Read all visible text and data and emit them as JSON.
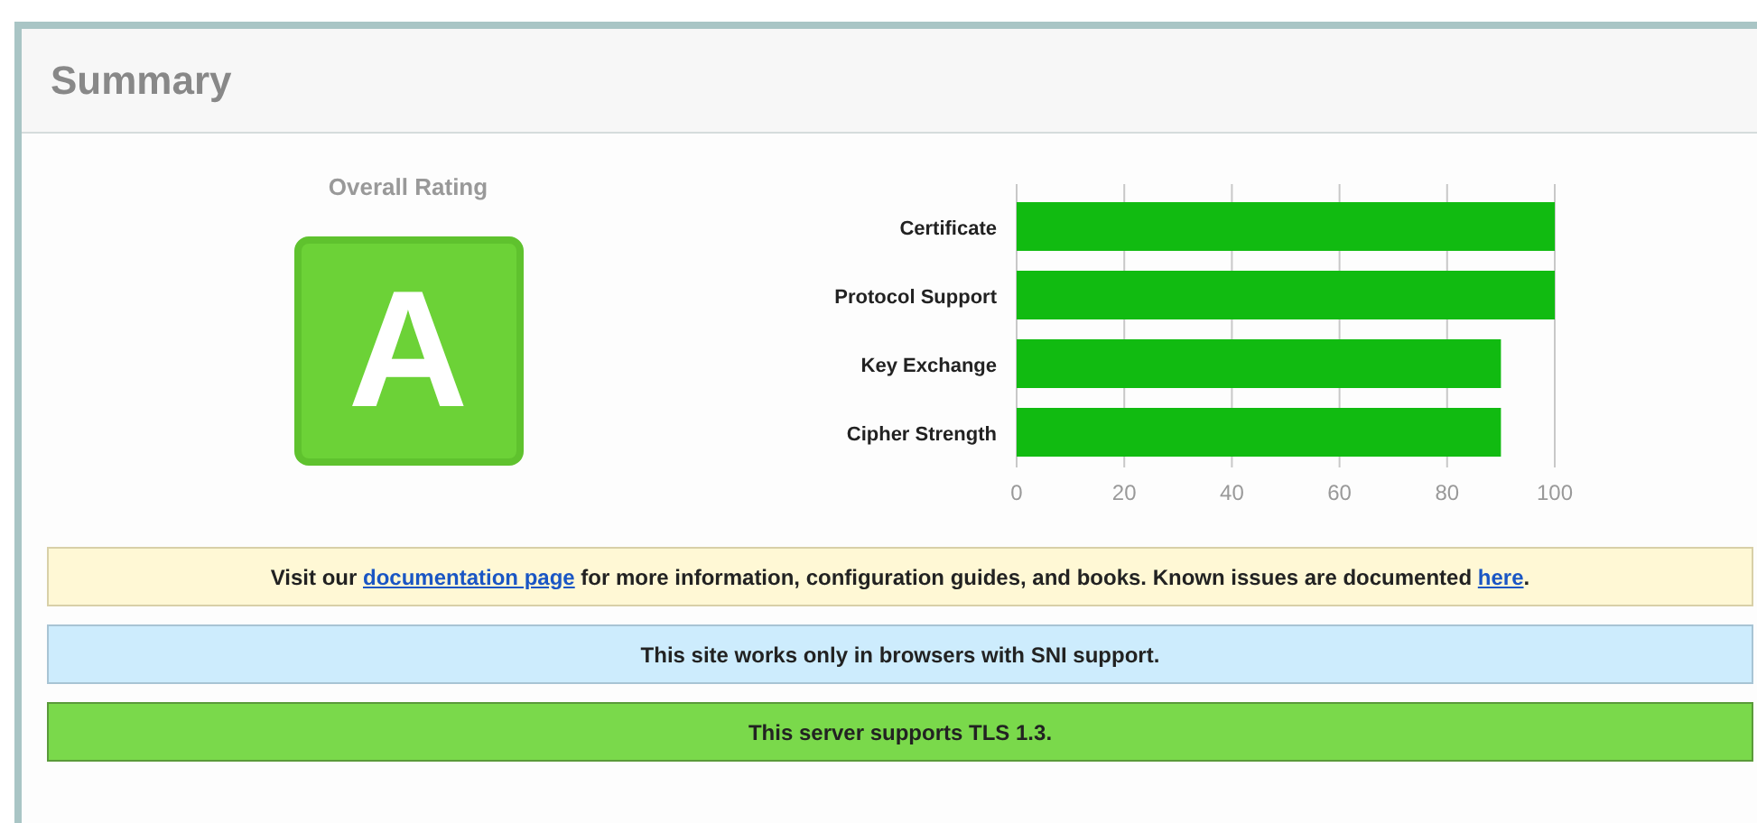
{
  "panel": {
    "title": "Summary"
  },
  "rating": {
    "label": "Overall Rating",
    "grade": "A"
  },
  "chart_data": {
    "type": "bar",
    "orientation": "horizontal",
    "categories": [
      "Certificate",
      "Protocol Support",
      "Key Exchange",
      "Cipher Strength"
    ],
    "series": [
      {
        "color": "#11bb11",
        "values": [
          100,
          100,
          90,
          90
        ]
      }
    ],
    "xlim": [
      0,
      100
    ],
    "xticks": [
      0,
      20,
      40,
      60,
      80,
      100
    ],
    "grid": true
  },
  "notices": [
    {
      "kind": "warning",
      "parts": [
        {
          "kind": "text",
          "text": "Visit our "
        },
        {
          "kind": "link",
          "text": "documentation page"
        },
        {
          "kind": "text",
          "text": " for more information, configuration guides, and books. Known issues are documented "
        },
        {
          "kind": "link",
          "text": "here"
        },
        {
          "kind": "text",
          "text": "."
        }
      ]
    },
    {
      "kind": "info",
      "parts": [
        {
          "kind": "text",
          "text": "This site works only in browsers with SNI support."
        }
      ]
    },
    {
      "kind": "success",
      "parts": [
        {
          "kind": "text",
          "text": "This server supports TLS 1.3."
        }
      ]
    }
  ]
}
